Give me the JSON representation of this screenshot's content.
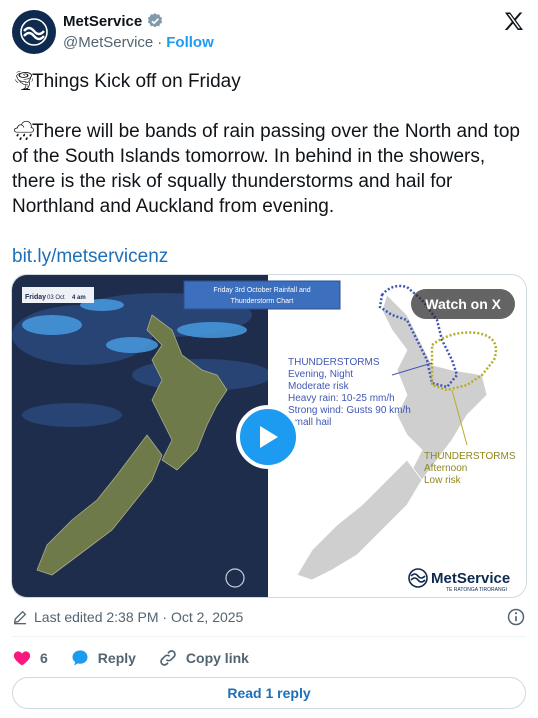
{
  "account": {
    "name": "MetService",
    "handle": "@MetService",
    "separator": "·",
    "follow_label": "Follow"
  },
  "tweet": {
    "line1_emoji": "🌪",
    "line1": "Things Kick off on Friday",
    "line2_emoji": "🌧",
    "line2": "There will be bands of rain passing over the North and top of the South Islands tomorrow. In behind in the showers, there is the risk of squally thunderstorms and hail for Northland and Auckland from evening.",
    "link": "bit.ly/metservicenz"
  },
  "media": {
    "watch_label": "Watch on X",
    "left_stamp_day": "Friday",
    "left_stamp_date": "03 Oct",
    "left_stamp_time": "4 am",
    "chart_title_line1": "Friday 3rd October Rainfall and",
    "chart_title_line2": "Thunderstorm Chart",
    "ts1_lines": [
      "THUNDERSTORMS",
      "Evening, Night",
      "Moderate risk",
      "Heavy rain: 10-25 mm/h",
      "Strong wind: Gusts 90 km/h",
      "Small hail"
    ],
    "ts2_lines": [
      "THUNDERSTORMS",
      "Afternoon",
      "Low risk"
    ],
    "brand_name": "MetService",
    "brand_sub": "TE RATONGA TIRORANGI",
    "colors": {
      "sea_dark": "#1c2b4a",
      "land": "#6f7a4a",
      "rain": "#3e8fd6",
      "moderate_risk": "#4157b5",
      "low_risk": "#b6ad2a"
    }
  },
  "meta": {
    "edited": "Last edited 2:38 PM · Oct 2, 2025"
  },
  "actions": {
    "like_count": "6",
    "reply_label": "Reply",
    "copy_label": "Copy link"
  },
  "read_reply_label": "Read 1 reply"
}
